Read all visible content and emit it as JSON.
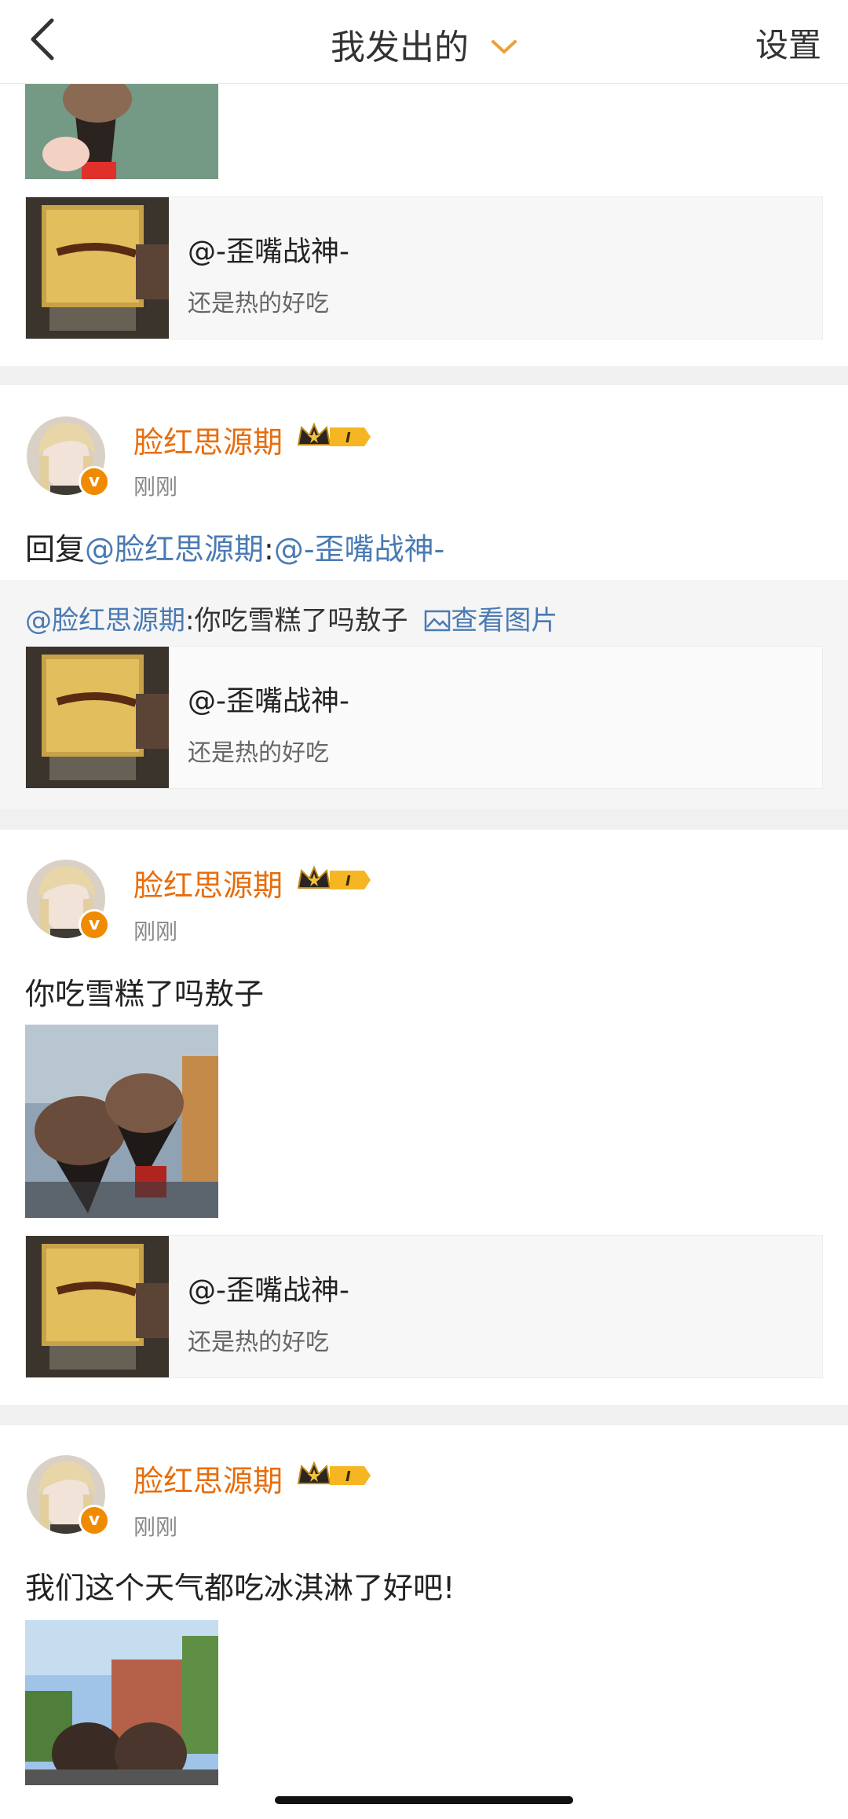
{
  "header": {
    "title": "我发出的",
    "settings_label": "设置",
    "icons": {
      "back": "chevron-left-icon",
      "dropdown": "chevron-down-icon"
    },
    "accent_color": "#e8a23a"
  },
  "colors": {
    "username": "#e86d0b",
    "link": "#4a7ab3",
    "separator": "#f0f0f0"
  },
  "top_fragment": {
    "card": {
      "title": "@-歪嘴战神-",
      "subtitle": "还是热的好吃"
    }
  },
  "posts": [
    {
      "username": "脸红思源期",
      "badge_level": "I",
      "timestamp": "刚刚",
      "reply_prefix": "回复",
      "reply_mention": "@脸红思源期",
      "reply_colon": ":",
      "reply_target": "@-歪嘴战神-",
      "quote_mention": "@脸红思源期",
      "quote_text": ":你吃雪糕了吗敖子",
      "view_image_label": "查看图片",
      "card": {
        "title": "@-歪嘴战神-",
        "subtitle": "还是热的好吃"
      }
    },
    {
      "username": "脸红思源期",
      "badge_level": "I",
      "timestamp": "刚刚",
      "text": "你吃雪糕了吗敖子",
      "card": {
        "title": "@-歪嘴战神-",
        "subtitle": "还是热的好吃"
      }
    },
    {
      "username": "脸红思源期",
      "badge_level": "I",
      "timestamp": "刚刚",
      "text": "我们这个天气都吃冰淇淋了好吧!"
    }
  ]
}
